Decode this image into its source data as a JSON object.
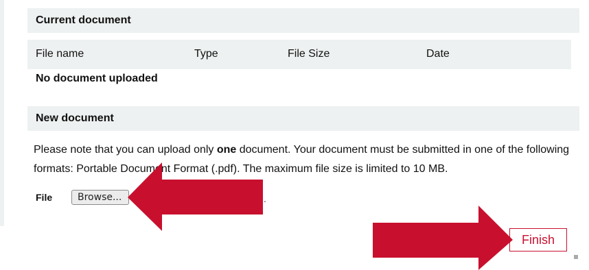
{
  "current": {
    "title": "Current document",
    "columns": [
      "File name",
      "Type",
      "File Size",
      "Date"
    ],
    "empty": "No document uploaded"
  },
  "new_doc": {
    "title": "New document",
    "note_prefix": "Please note that you can upload only ",
    "note_bold": "one",
    "note_suffix": " document. Your document must be submitted in one of the following formats: Portable Document Format (.pdf). The maximum file size is limited to 10 MB."
  },
  "file": {
    "label": "File",
    "browse": "Browse...",
    "status_tail": "."
  },
  "finish": "Finish",
  "colors": {
    "arrow": "#c8102e",
    "bar": "#eef1f1",
    "accent": "#c8102e"
  }
}
